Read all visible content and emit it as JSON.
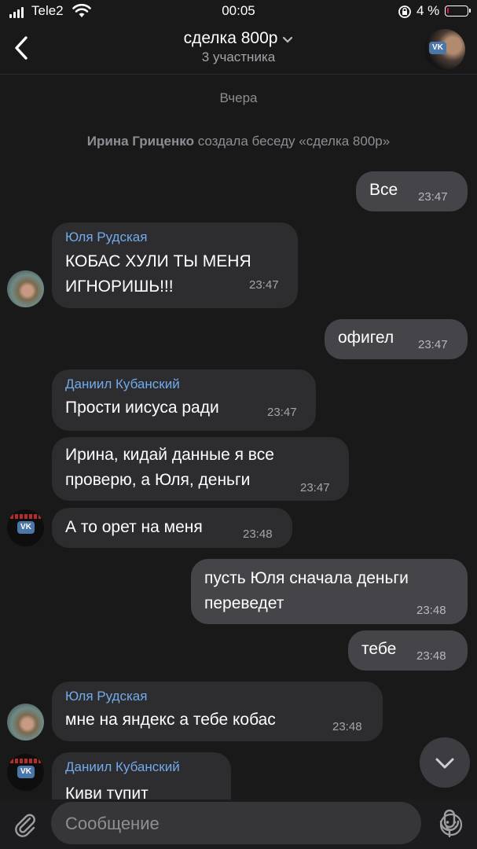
{
  "status_bar": {
    "carrier": "Tele2",
    "time": "00:05",
    "battery": "4 %"
  },
  "header": {
    "title": "сделка 800р",
    "subtitle": "3 участника"
  },
  "date_separator": "Вчера",
  "system_message": {
    "author": "Ирина Гриценко",
    "text": "создала беседу «сделка 800р»"
  },
  "messages": [
    {
      "text": "Все",
      "time": "23:47"
    },
    {
      "sender": "Юля Рудская",
      "text": "КОБАС ХУЛИ ТЫ МЕНЯ\nИГНОРИШЬ!!!",
      "time": "23:47"
    },
    {
      "text": "офигел",
      "time": "23:47"
    },
    {
      "sender": "Даниил Кубанский",
      "text": "Прости иисуса ради",
      "time": "23:47"
    },
    {
      "text": "Ирина, кидай данные я все\nпроверю, а Юля, деньги",
      "time": "23:47"
    },
    {
      "text": "А то орет на меня",
      "time": "23:48"
    },
    {
      "text": "пусть Юля сначала деньги\nпереведет",
      "time": "23:48"
    },
    {
      "text": "тебе",
      "time": "23:48"
    },
    {
      "sender": "Юля Рудская",
      "text": "мне на яндекс а тебе кобас",
      "time": "23:48"
    },
    {
      "sender": "Даниил Кубанский",
      "text": "Киви тупит"
    }
  ],
  "avatar_badge": "VK",
  "composer": {
    "placeholder": "Сообщение"
  },
  "colors": {
    "background": "#19191a",
    "incoming_bubble": "#2d2d30",
    "outgoing_bubble": "#454549",
    "sender_name": "#71aaeb"
  }
}
